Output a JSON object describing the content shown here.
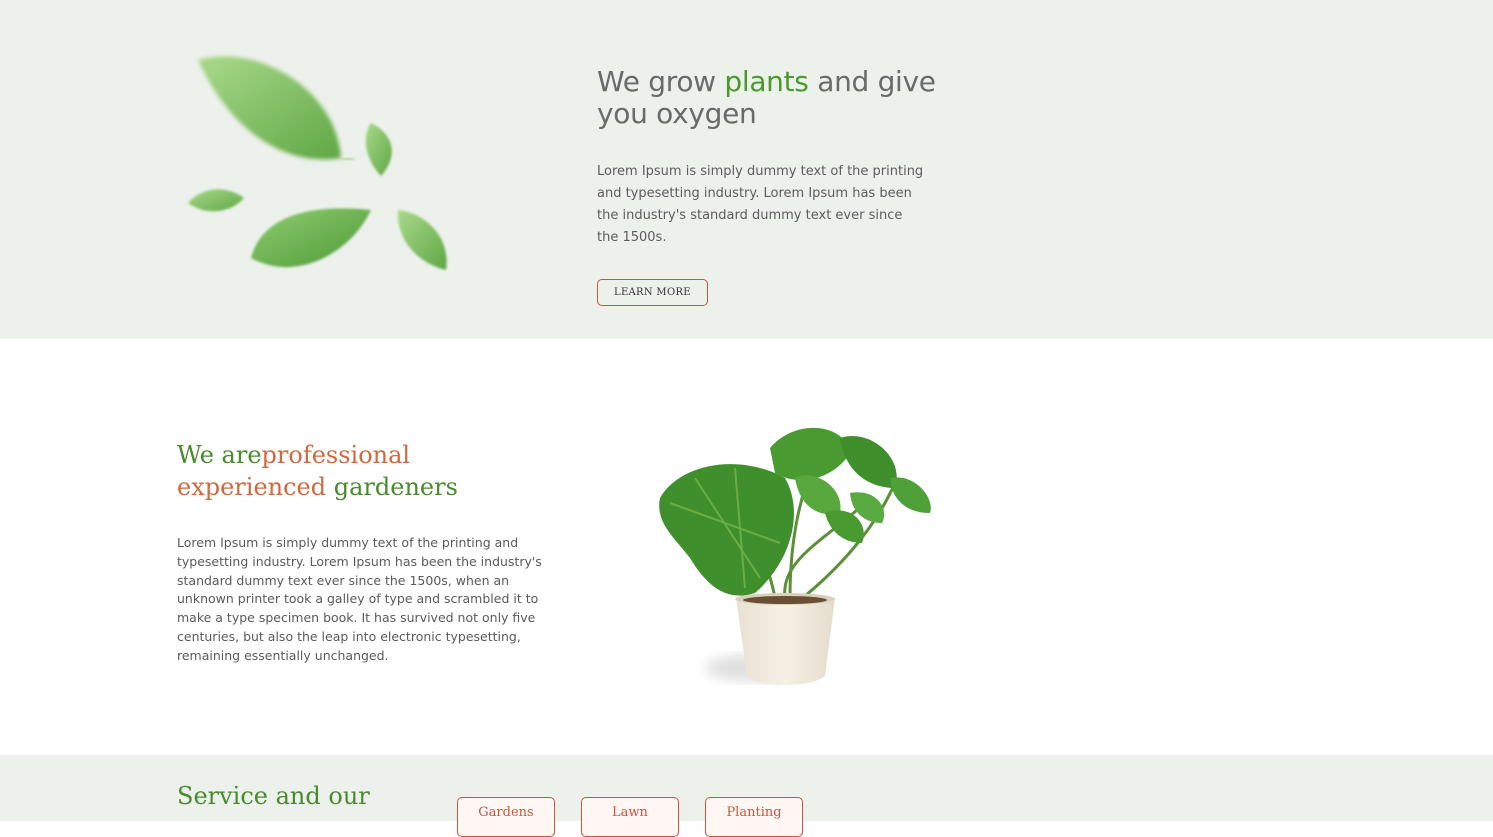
{
  "hero": {
    "title_part1": "We grow ",
    "title_accent": "plants",
    "title_part2": " and give you oxygen",
    "description": "Lorem Ipsum is simply dummy text of the printing and typesetting industry. Lorem Ipsum has been the industry's standard dummy text ever since the 1500s.",
    "button_label": "LEARN MORE"
  },
  "about": {
    "title_part1": "We are",
    "title_orange": "professional experienced",
    "title_part2": " gardeners",
    "description": "Lorem Ipsum is simply dummy text of the printing and typesetting industry. Lorem Ipsum has been the industry's standard dummy text ever since the 1500s, when an unknown printer took a galley of type and scrambled it to make a type specimen book. It has survived not only five centuries, but also the leap into electronic typesetting, remaining essentially unchanged."
  },
  "services": {
    "title": "Service and our",
    "tabs": [
      {
        "label": "Gardens"
      },
      {
        "label": "Lawn"
      },
      {
        "label": "Planting"
      }
    ]
  },
  "colors": {
    "green_accent": "#4a9a2a",
    "orange_accent": "#d06840",
    "button_border": "#c8553d",
    "section_bg": "#edf1ec"
  }
}
